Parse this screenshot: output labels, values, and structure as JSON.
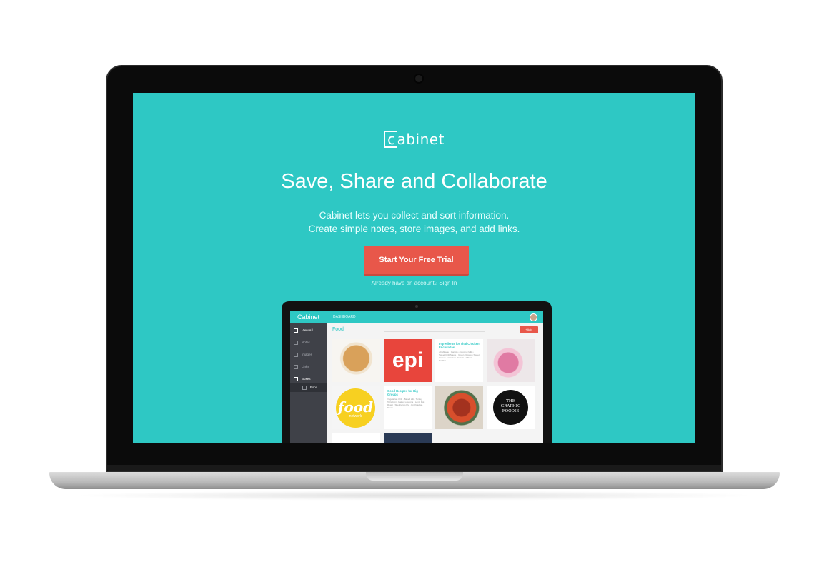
{
  "landing": {
    "logo_c": "c",
    "logo_rest": "abinet",
    "headline": "Save, Share and Collaborate",
    "sub_line1": "Cabinet lets you collect and sort information.",
    "sub_line2": "Create simple notes, store images, and add links.",
    "cta_label": "Start Your Free Trial",
    "signin_text": "Already have an account? Sign In"
  },
  "app": {
    "logo": "Cabinet",
    "header_tab": "DASHBOARD",
    "sidebar": [
      "View All",
      "Notes",
      "Images",
      "Links",
      "Boxes",
      "Food"
    ],
    "section_title": "Food",
    "add_label": "+Add",
    "cards": {
      "epi_label": "epi",
      "note1_title": "Ingredients for Thai Chicken Enchiladas",
      "note1_items": "• Cabbage • Carrots • Coconut Milk • Sweet Chili Sauce • Green Onions • Sweet Onion • 2 Chicken Breasts • Wheat Tortillas",
      "food_word": "food",
      "food_sub": "network",
      "note2_title": "Good Recipes for Big Groups",
      "note2_items": "Vegetarian Chili · Baked Ziti · Turkey Tetrazzini · Baked Lasagna · Lentil Pot Roast · Shepherd's Pie · Enchiladas · Tacos",
      "graphic_line1": "THE",
      "graphic_line2": "GRAPHIC",
      "graphic_line3": "FOODIE"
    }
  },
  "colors": {
    "teal": "#2ec8c4",
    "cta": "#e8574a",
    "sidebar": "#3f4148"
  }
}
